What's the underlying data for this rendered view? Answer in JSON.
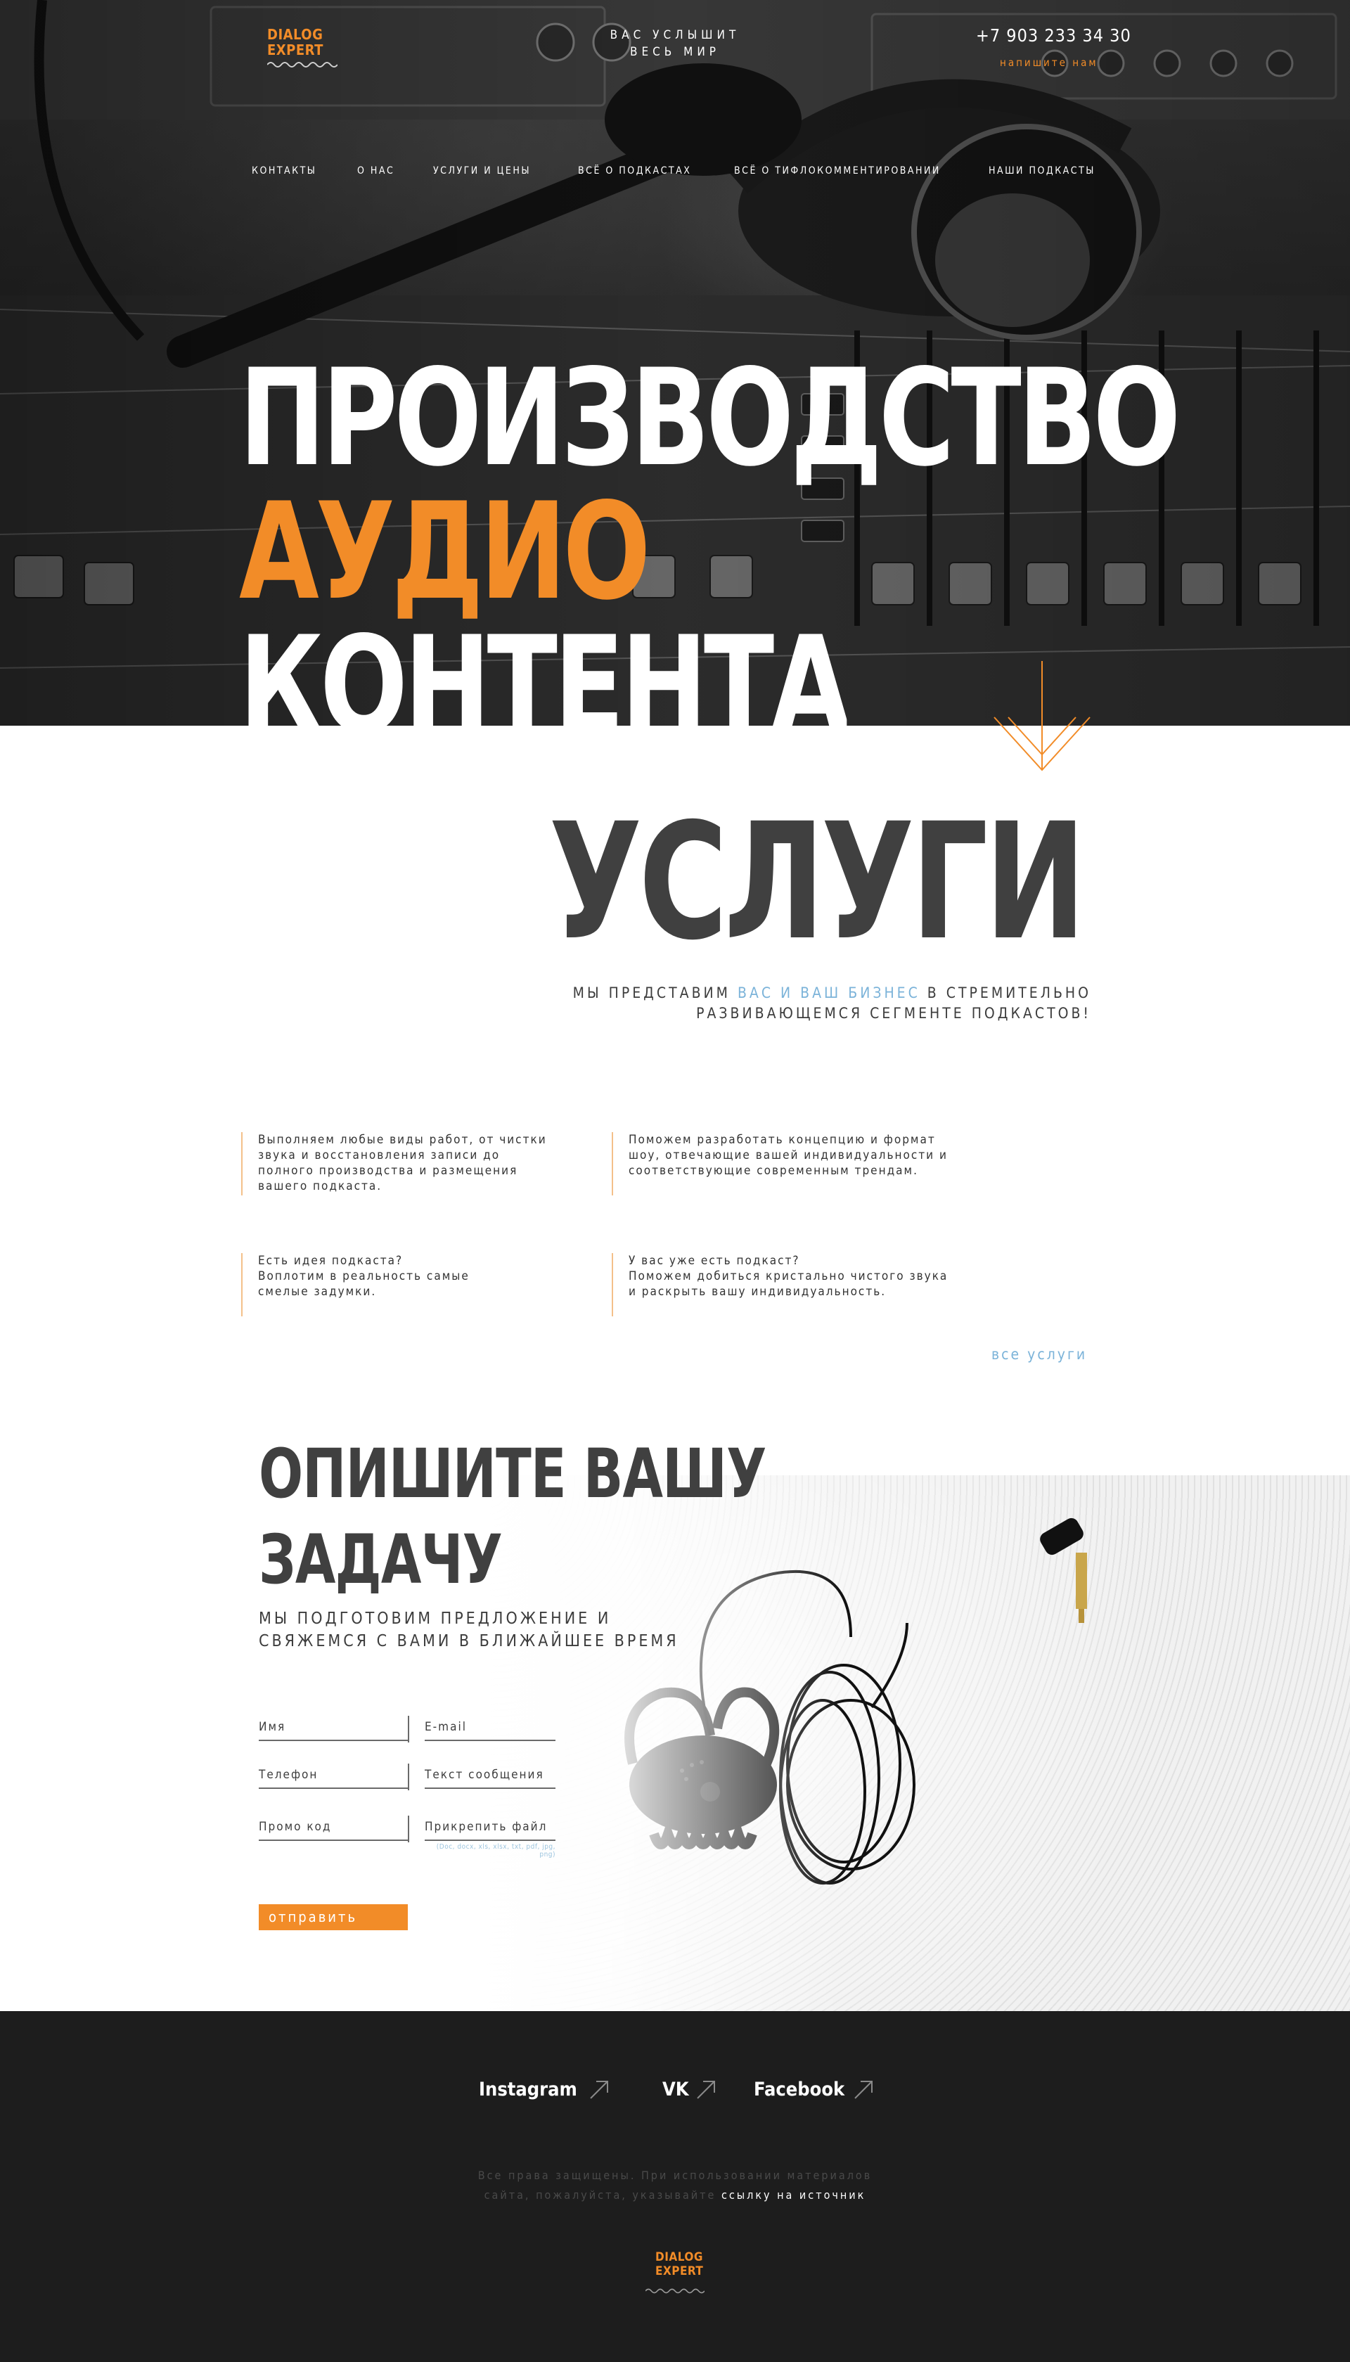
{
  "header": {
    "logo_line1": "DIALOG",
    "logo_line2": "EXPERT",
    "tagline_line1": "ВАС УСЛЫШИТ",
    "tagline_line2": "ВЕСЬ МИР",
    "phone": "+7 903 233 34 30",
    "write_us": "напишите нам"
  },
  "nav": {
    "items": [
      {
        "label": "КОНТАКТЫ"
      },
      {
        "label": "О НАС"
      },
      {
        "label": "УСЛУГИ И ЦЕНЫ"
      },
      {
        "label": "ВСЁ О ПОДКАСТАХ"
      },
      {
        "label": "ВСЁ О ТИФЛОКОММЕНТИРОВАНИИ"
      },
      {
        "label": "НАШИ ПОДКАСТЫ"
      }
    ]
  },
  "hero": {
    "line1": "ПРОИЗВОДСТВО",
    "line2": "АУДИО",
    "line3": "КОНТЕНТА"
  },
  "services": {
    "title": "УСЛУГИ",
    "subtitle_a": "МЫ ПРЕДСТАВИМ ",
    "subtitle_highlight": "ВАС И ВАШ БИЗНЕС",
    "subtitle_b": " В СТРЕМИТЕЛЬНО",
    "subtitle_line2": "РАЗВИВАЮЩЕМСЯ СЕГМЕНТЕ ПОДКАСТОВ!",
    "items": [
      {
        "line1": "Выполняем любые виды работ, от чистки",
        "line2": "звука и восстановления записи до",
        "line3": "полного производства и размещения",
        "line4": "вашего подкаста."
      },
      {
        "line1": "Поможем разработать концепцию и формат",
        "line2": "шоу, отвечающие вашей индивидуальности и",
        "line3": "соответствующие современным трендам.",
        "line4": ""
      },
      {
        "line1": "Есть идея подкаста?",
        "line2": "Воплотим в реальность самые",
        "line3": "смелые задумки.",
        "line4": ""
      },
      {
        "line1": "У вас уже есть подкаст?",
        "line2": "Поможем добиться кристально чистого звука",
        "line3": "и раскрыть вашу индивидуальность.",
        "line4": ""
      }
    ],
    "all_link": "все услуги"
  },
  "form": {
    "title_line1": "ОПИШИТЕ ВАШУ",
    "title_line2": "ЗАДАЧУ",
    "subtitle_line1": "МЫ ПОДГОТОВИМ ПРЕДЛОЖЕНИЕ И",
    "subtitle_line2": "СВЯЖЕМСЯ С ВАМИ В БЛИЖАЙШЕЕ ВРЕМЯ",
    "name_placeholder": "Имя",
    "email_placeholder": "E-mail",
    "phone_placeholder": "Телефон",
    "message_placeholder": "Текст сообщения",
    "promo_placeholder": "Промо код",
    "attach_label": "Прикрепить файл",
    "file_types": "(Doc, docx, xls, xlsx, txt, pdf, jpg, png)",
    "submit_label": "отправить"
  },
  "footer": {
    "socials": [
      {
        "label": "Instagram"
      },
      {
        "label": "VK"
      },
      {
        "label": "Facebook"
      }
    ],
    "copyright_line1": "Все права защищены. При использовании материалов",
    "copyright_line2a": "сайта, пожалуйста, указывайте ",
    "copyright_link": "ссылку на источник",
    "logo_line1": "DIALOG",
    "logo_line2": "EXPERT"
  },
  "colors": {
    "accent": "#f28c28",
    "link": "#7bb3d9",
    "dark_text": "#404040",
    "footer_bg": "#1d1d1d"
  }
}
